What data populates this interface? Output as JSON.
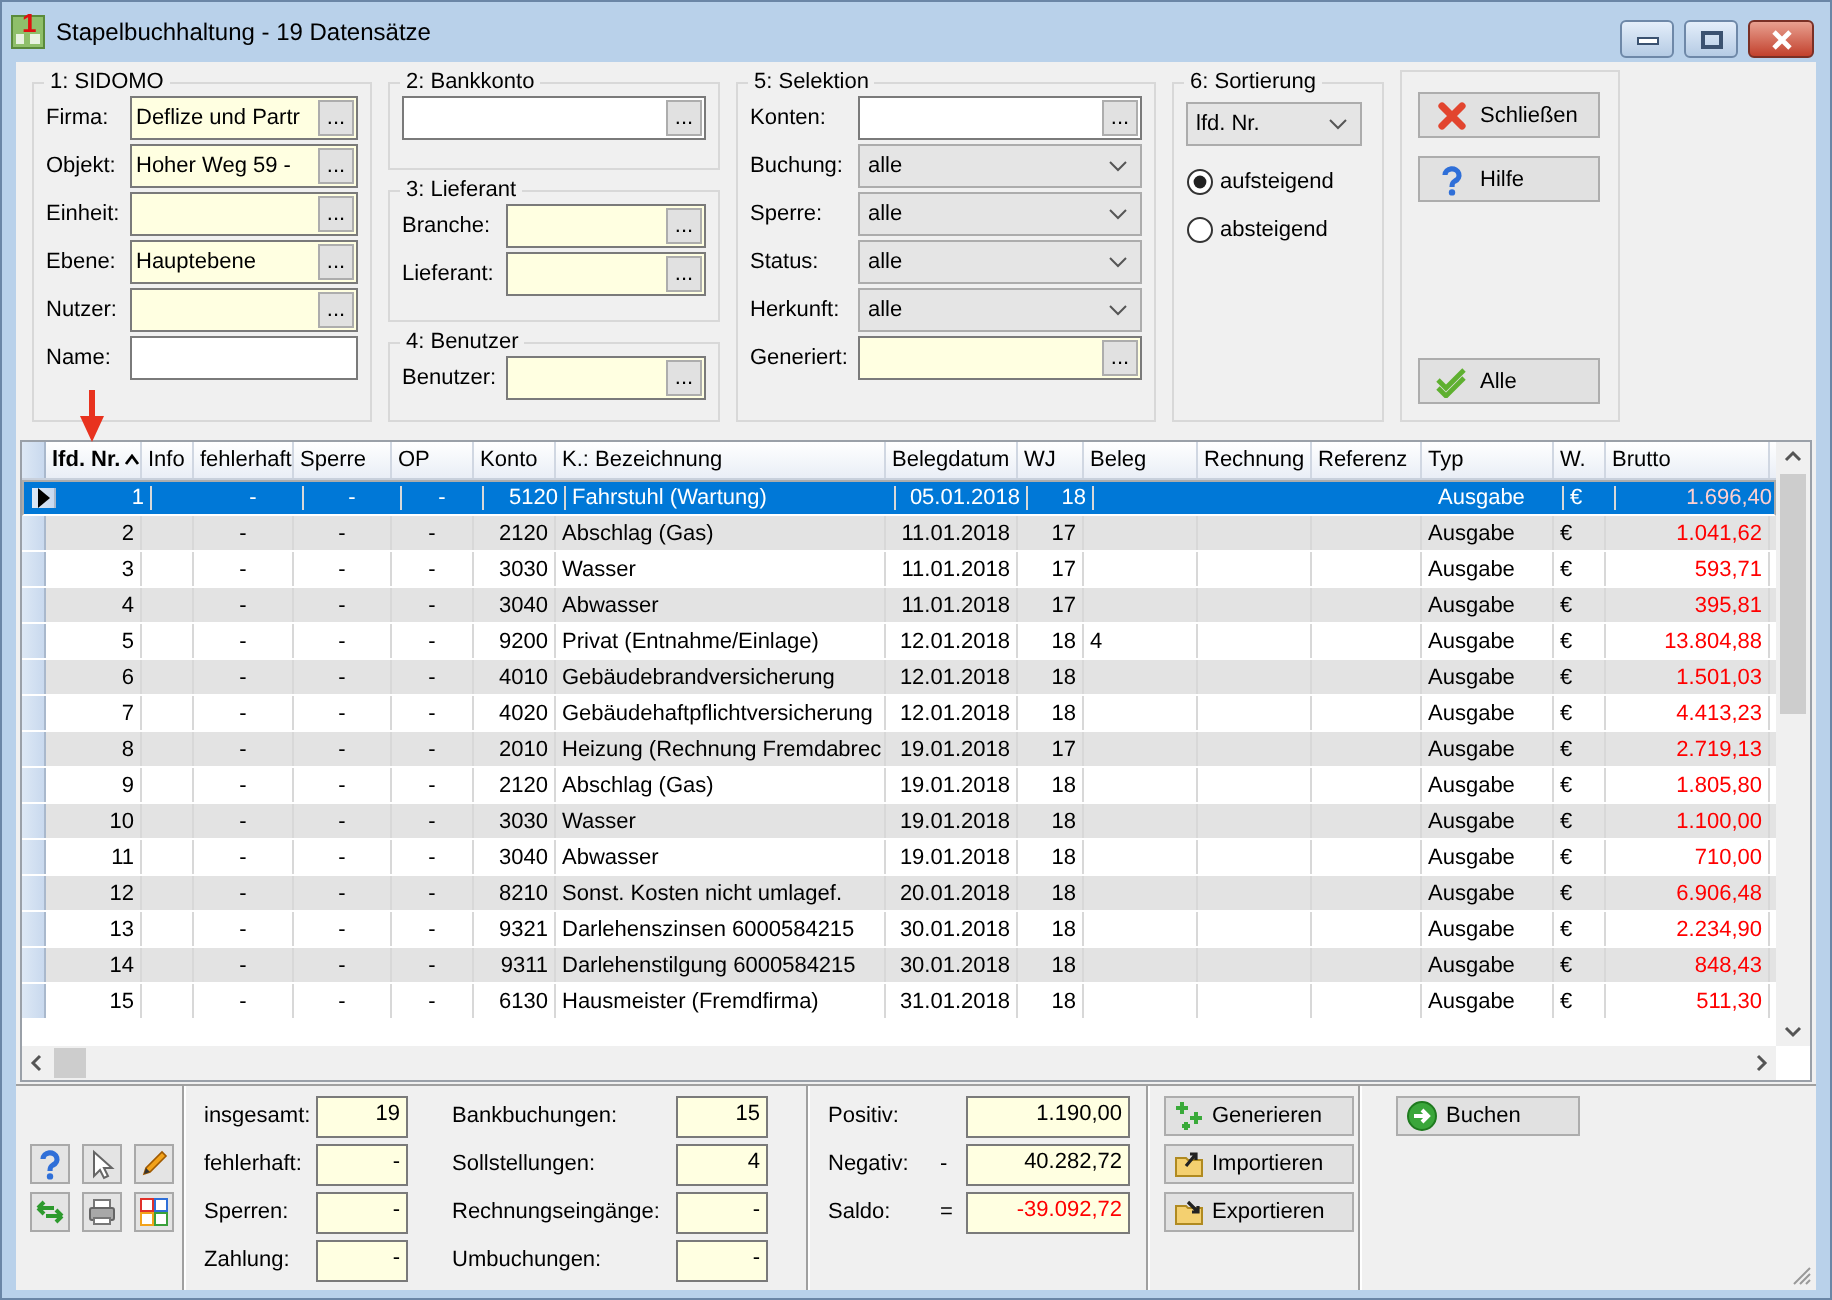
{
  "window": {
    "icon_text": "1",
    "title": "Stapelbuchhaltung - 19 Datensätze"
  },
  "filters": {
    "sidomo": {
      "title": "1: SIDOMO",
      "fields": [
        {
          "label": "Firma:",
          "kind": "lookup",
          "value": "Deflize und Partr",
          "highlighted": true,
          "button": "..."
        },
        {
          "label": "Objekt:",
          "kind": "lookup",
          "value": "Hoher Weg 59 -",
          "highlighted": true,
          "button": "..."
        },
        {
          "label": "Einheit:",
          "kind": "lookup",
          "highlighted": true,
          "button": "..."
        },
        {
          "label": "Ebene:",
          "kind": "lookup",
          "value": "Hauptebene",
          "highlighted": true,
          "button": "..."
        },
        {
          "label": "Nutzer:",
          "kind": "lookup",
          "highlighted": true,
          "button": "..."
        },
        {
          "label": "Name:",
          "kind": "text",
          "highlighted": false
        }
      ]
    },
    "bankkonto": {
      "title": "2: Bankkonto",
      "fields": [
        {
          "kind": "lookup",
          "highlighted": false,
          "button": "..."
        }
      ]
    },
    "lieferant": {
      "title": "3: Lieferant",
      "fields": [
        {
          "label": "Branche:",
          "kind": "lookup",
          "highlighted": true,
          "button": "..."
        },
        {
          "label": "Lieferant:",
          "kind": "lookup",
          "highlighted": true,
          "button": "..."
        }
      ]
    },
    "benutzer": {
      "title": "4: Benutzer",
      "fields": [
        {
          "label": "Benutzer:",
          "kind": "lookup",
          "highlighted": true,
          "button": "..."
        }
      ]
    },
    "selektion": {
      "title": "5: Selektion",
      "fields": [
        {
          "label": "Konten:",
          "kind": "lookup",
          "highlighted": false,
          "button": "..."
        },
        {
          "label": "Buchung:",
          "kind": "select",
          "value": "alle"
        },
        {
          "label": "Sperre:",
          "kind": "select",
          "value": "alle"
        },
        {
          "label": "Status:",
          "kind": "select",
          "value": "alle"
        },
        {
          "label": "Herkunft:",
          "kind": "select",
          "value": "alle"
        },
        {
          "label": "Generiert:",
          "kind": "lookup",
          "highlighted": true,
          "button": "..."
        }
      ]
    },
    "sortierung": {
      "title": "6: Sortierung",
      "select": {
        "value": "lfd. Nr."
      },
      "options": [
        {
          "label": "aufsteigend",
          "selected": true
        },
        {
          "label": "absteigend",
          "selected": false
        }
      ]
    },
    "actions": [
      {
        "label": "Schließen",
        "kind": "close"
      },
      {
        "label": "Hilfe",
        "kind": "help"
      },
      {
        "label": "Alle",
        "kind": "check"
      }
    ]
  },
  "table": {
    "columns": [
      {
        "label": "lfd. Nr.",
        "kind": "number",
        "sorted": true
      },
      {
        "label": "Info",
        "kind": "text",
        "sorted": false
      },
      {
        "label": "fehlerhaft",
        "kind": "center",
        "sorted": false
      },
      {
        "label": "Sperre",
        "kind": "center",
        "sorted": false
      },
      {
        "label": "OP",
        "kind": "center",
        "sorted": false
      },
      {
        "label": "Konto",
        "kind": "number",
        "sorted": false
      },
      {
        "label": "K.: Bezeichnung",
        "kind": "text",
        "sorted": false
      },
      {
        "label": "Belegdatum",
        "kind": "number",
        "sorted": false
      },
      {
        "label": "WJ",
        "kind": "number",
        "sorted": false
      },
      {
        "label": "Beleg",
        "kind": "text",
        "sorted": false
      },
      {
        "label": "Rechnung",
        "kind": "text",
        "sorted": false
      },
      {
        "label": "Referenz",
        "kind": "text",
        "sorted": false
      },
      {
        "label": "Typ",
        "kind": "text",
        "sorted": false
      },
      {
        "label": "W.",
        "kind": "text",
        "sorted": false
      },
      {
        "label": "Brutto",
        "kind": "amount",
        "sorted": false
      }
    ],
    "rows": [
      {
        "selected": true,
        "negative": true,
        "cells": [
          "1",
          null,
          "-",
          "-",
          "-",
          "5120",
          "Fahrstuhl (Wartung)",
          "05.01.2018",
          "18",
          null,
          null,
          null,
          "Ausgabe",
          "€",
          "1.696,40"
        ]
      },
      {
        "selected": false,
        "negative": true,
        "cells": [
          "2",
          null,
          "-",
          "-",
          "-",
          "2120",
          "Abschlag (Gas)",
          "11.01.2018",
          "17",
          null,
          null,
          null,
          "Ausgabe",
          "€",
          "1.041,62"
        ]
      },
      {
        "selected": false,
        "negative": true,
        "cells": [
          "3",
          null,
          "-",
          "-",
          "-",
          "3030",
          "Wasser",
          "11.01.2018",
          "17",
          null,
          null,
          null,
          "Ausgabe",
          "€",
          "593,71"
        ]
      },
      {
        "selected": false,
        "negative": true,
        "cells": [
          "4",
          null,
          "-",
          "-",
          "-",
          "3040",
          "Abwasser",
          "11.01.2018",
          "17",
          null,
          null,
          null,
          "Ausgabe",
          "€",
          "395,81"
        ]
      },
      {
        "selected": false,
        "negative": true,
        "cells": [
          "5",
          null,
          "-",
          "-",
          "-",
          "9200",
          "Privat (Entnahme/Einlage)",
          "12.01.2018",
          "18",
          "4",
          null,
          null,
          "Ausgabe",
          "€",
          "13.804,88"
        ]
      },
      {
        "selected": false,
        "negative": true,
        "cells": [
          "6",
          null,
          "-",
          "-",
          "-",
          "4010",
          "Gebäudebrandversicherung",
          "12.01.2018",
          "18",
          null,
          null,
          null,
          "Ausgabe",
          "€",
          "1.501,03"
        ]
      },
      {
        "selected": false,
        "negative": true,
        "cells": [
          "7",
          null,
          "-",
          "-",
          "-",
          "4020",
          "Gebäudehaftpflichtversicherung",
          "12.01.2018",
          "18",
          null,
          null,
          null,
          "Ausgabe",
          "€",
          "4.413,23"
        ]
      },
      {
        "selected": false,
        "negative": true,
        "cells": [
          "8",
          null,
          "-",
          "-",
          "-",
          "2010",
          "Heizung (Rechnung Fremdabrec",
          "19.01.2018",
          "17",
          null,
          null,
          null,
          "Ausgabe",
          "€",
          "2.719,13"
        ]
      },
      {
        "selected": false,
        "negative": true,
        "cells": [
          "9",
          null,
          "-",
          "-",
          "-",
          "2120",
          "Abschlag (Gas)",
          "19.01.2018",
          "18",
          null,
          null,
          null,
          "Ausgabe",
          "€",
          "1.805,80"
        ]
      },
      {
        "selected": false,
        "negative": true,
        "cells": [
          "10",
          null,
          "-",
          "-",
          "-",
          "3030",
          "Wasser",
          "19.01.2018",
          "18",
          null,
          null,
          null,
          "Ausgabe",
          "€",
          "1.100,00"
        ]
      },
      {
        "selected": false,
        "negative": true,
        "cells": [
          "11",
          null,
          "-",
          "-",
          "-",
          "3040",
          "Abwasser",
          "19.01.2018",
          "18",
          null,
          null,
          null,
          "Ausgabe",
          "€",
          "710,00"
        ]
      },
      {
        "selected": false,
        "negative": true,
        "cells": [
          "12",
          null,
          "-",
          "-",
          "-",
          "8210",
          "Sonst. Kosten nicht umlagef.",
          "20.01.2018",
          "18",
          null,
          null,
          null,
          "Ausgabe",
          "€",
          "6.906,48"
        ]
      },
      {
        "selected": false,
        "negative": true,
        "cells": [
          "13",
          null,
          "-",
          "-",
          "-",
          "9321",
          "Darlehenszinsen 6000584215",
          "30.01.2018",
          "18",
          null,
          null,
          null,
          "Ausgabe",
          "€",
          "2.234,90"
        ]
      },
      {
        "selected": false,
        "negative": true,
        "cells": [
          "14",
          null,
          "-",
          "-",
          "-",
          "9311",
          "Darlehenstilgung 6000584215",
          "30.01.2018",
          "18",
          null,
          null,
          null,
          "Ausgabe",
          "€",
          "848,43"
        ]
      },
      {
        "selected": false,
        "negative": true,
        "cells": [
          "15",
          null,
          "-",
          "-",
          "-",
          "6130",
          "Hausmeister (Fremdfirma)",
          "31.01.2018",
          "18",
          null,
          null,
          null,
          "Ausgabe",
          "€",
          "511,30"
        ]
      }
    ]
  },
  "tools": [
    {
      "kind": "help"
    },
    {
      "kind": "pointer"
    },
    {
      "kind": "pencil"
    },
    {
      "kind": "swap"
    },
    {
      "kind": "printer"
    },
    {
      "kind": "layout"
    }
  ],
  "counts": [
    {
      "label": "insgesamt:",
      "value": "19"
    },
    {
      "label": "fehlerhaft:",
      "value": "-"
    },
    {
      "label": "Sperren:",
      "value": "-"
    },
    {
      "label": "Zahlung:",
      "value": "-"
    },
    {
      "label": "Bankbuchungen:",
      "value": "15"
    },
    {
      "label": "Sollstellungen:",
      "value": "4"
    },
    {
      "label": "Rechnungseingänge:",
      "value": "-"
    },
    {
      "label": "Umbuchungen:",
      "value": "-"
    }
  ],
  "totals": [
    {
      "label": "Positiv:",
      "value": "1.190,00",
      "negative": false
    },
    {
      "label": "Negativ:",
      "sign": "-",
      "value": "40.282,72",
      "negative": false
    },
    {
      "label": "Saldo:",
      "sign": "=",
      "value": "-39.092,72",
      "negative": true
    }
  ],
  "transfer_buttons": [
    {
      "label": "Generieren",
      "kind": "generate"
    },
    {
      "label": "Importieren",
      "kind": "import"
    },
    {
      "label": "Exportieren",
      "kind": "export"
    }
  ],
  "post_button": {
    "label": "Buchen",
    "kind": "go"
  }
}
